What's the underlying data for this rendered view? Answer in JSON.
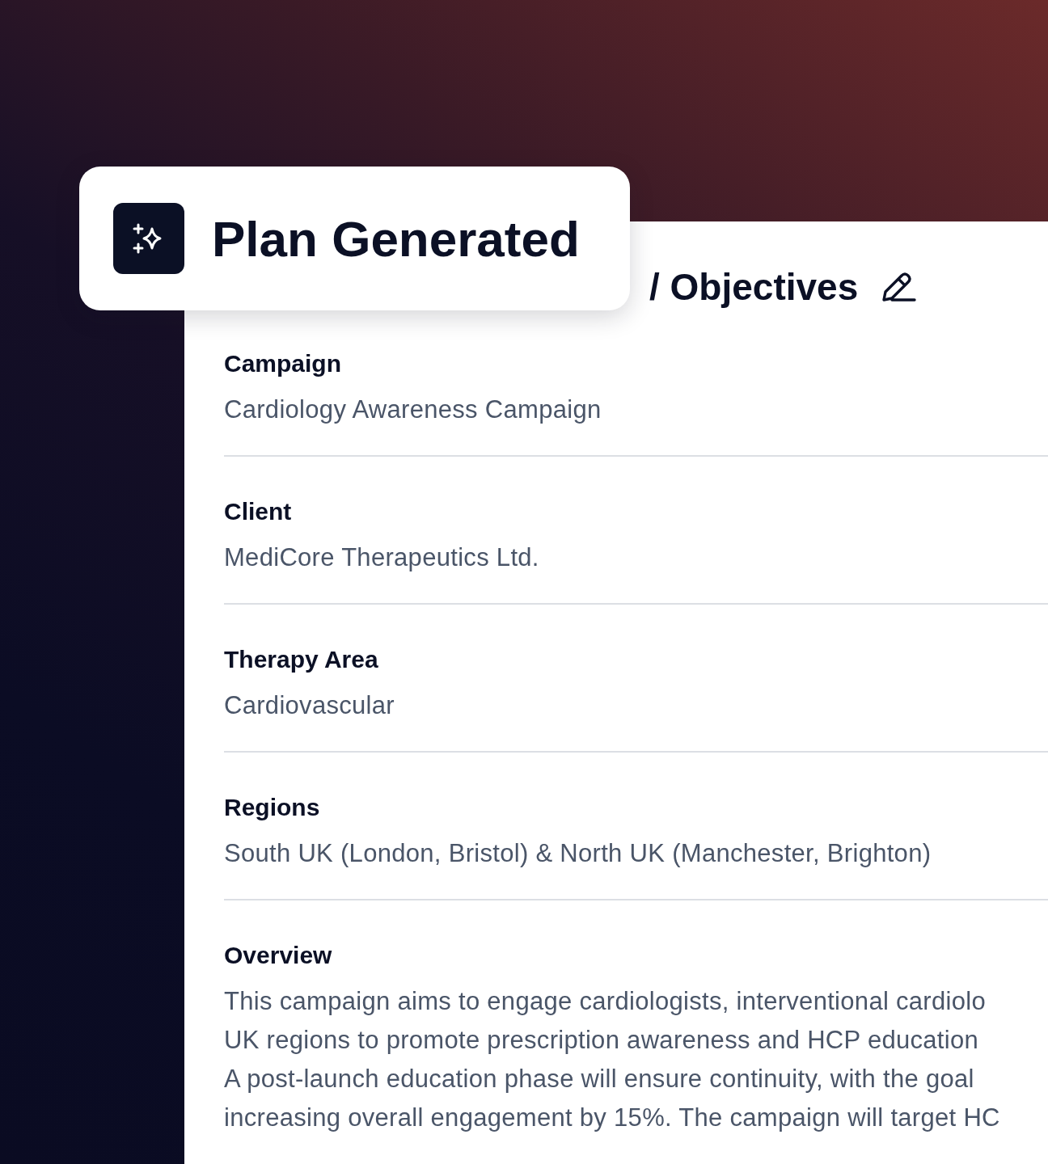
{
  "toast": {
    "title": "Plan Generated"
  },
  "panel": {
    "heading": "/ Objectives",
    "fields": [
      {
        "label": "Campaign",
        "value": "Cardiology Awareness Campaign"
      },
      {
        "label": "Client",
        "value": "MediCore Therapeutics Ltd."
      },
      {
        "label": "Therapy Area",
        "value": "Cardiovascular"
      },
      {
        "label": "Regions",
        "value": "South UK (London, Bristol) & North UK (Manchester, Brighton)"
      }
    ],
    "overview": {
      "label": "Overview",
      "lines": [
        "This campaign aims to engage cardiologists, interventional cardiolo",
        "UK regions to promote prescription awareness and HCP education",
        "A post-launch education phase will ensure continuity, with the goal",
        "increasing overall engagement by 15%. The campaign will target HC"
      ]
    }
  }
}
